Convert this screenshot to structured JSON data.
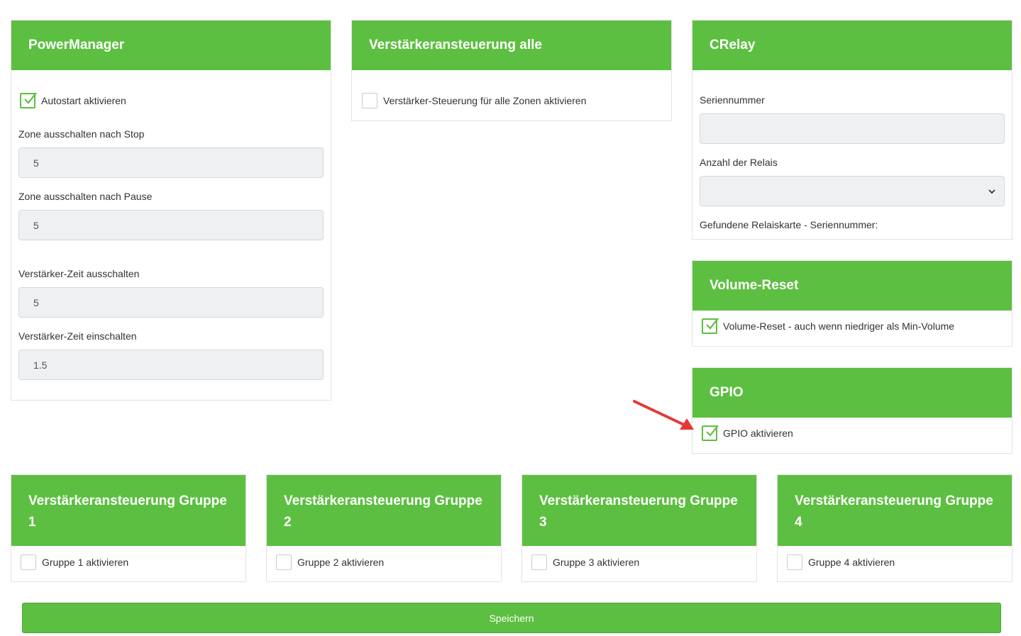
{
  "powermanager": {
    "title": "PowerManager",
    "autostart_label": "Autostart aktivieren",
    "autostart_checked": true,
    "zone_stop_label": "Zone ausschalten nach Stop",
    "zone_stop_value": "5",
    "zone_pause_label": "Zone ausschalten nach Pause",
    "zone_pause_value": "5",
    "amp_off_label": "Verstärker-Zeit ausschalten",
    "amp_off_value": "5",
    "amp_on_label": "Verstärker-Zeit einschalten",
    "amp_on_value": "1.5"
  },
  "amp_all": {
    "title": "Verstärkeransteuerung alle",
    "checkbox_label": "Verstärker-Steuerung für alle Zonen aktivieren",
    "checked": false
  },
  "crelay": {
    "title": "CRelay",
    "serial_label": "Seriennummer",
    "serial_value": "",
    "relay_count_label": "Anzahl der Relais",
    "relay_count_value": "",
    "found_label": "Gefundene Relaiskarte - Seriennummer:"
  },
  "volume_reset": {
    "title": "Volume-Reset",
    "checkbox_label": "Volume-Reset - auch wenn niedriger als Min-Volume",
    "checked": true
  },
  "gpio": {
    "title": "GPIO",
    "checkbox_label": "GPIO aktivieren",
    "checked": true
  },
  "groups": [
    {
      "title_line1": "Verstärkeransteuerung Gruppe",
      "title_line2": "1",
      "checkbox_label": "Gruppe 1 aktivieren",
      "checked": false
    },
    {
      "title_line1": "Verstärkeransteuerung Gruppe",
      "title_line2": "2",
      "checkbox_label": "Gruppe 2 aktivieren",
      "checked": false
    },
    {
      "title_line1": "Verstärkeransteuerung Gruppe",
      "title_line2": "3",
      "checkbox_label": "Gruppe 3 aktivieren",
      "checked": false
    },
    {
      "title_line1": "Verstärkeransteuerung Gruppe",
      "title_line2": "4",
      "checkbox_label": "Gruppe 4 aktivieren",
      "checked": false
    }
  ],
  "save_label": "Speichern",
  "colors": {
    "accent": "#5dbf41",
    "annotation_arrow": "#e53935"
  }
}
